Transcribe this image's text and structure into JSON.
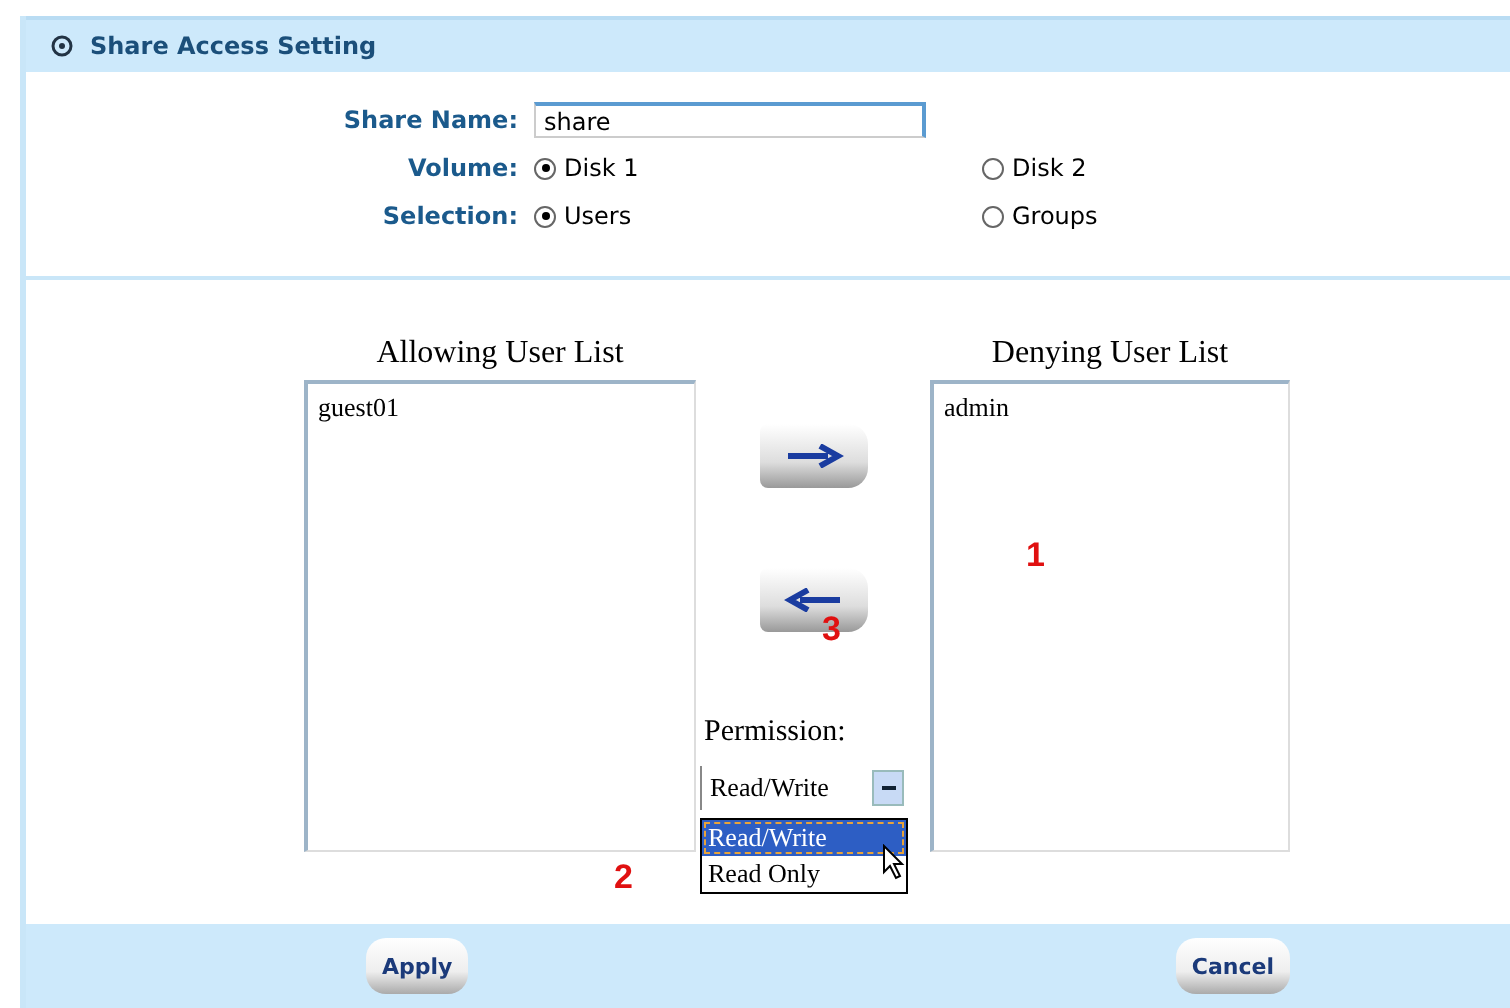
{
  "panel": {
    "title": "Share Access Setting"
  },
  "form": {
    "share_name": {
      "label": "Share Name:",
      "value": "share"
    },
    "volume": {
      "label": "Volume:",
      "options": [
        {
          "label": "Disk 1",
          "selected": true
        },
        {
          "label": "Disk 2",
          "selected": false
        }
      ]
    },
    "selection": {
      "label": "Selection:",
      "options": [
        {
          "label": "Users",
          "selected": true
        },
        {
          "label": "Groups",
          "selected": false
        }
      ]
    }
  },
  "allowing_list": {
    "title": "Allowing User List",
    "items": [
      "guest01"
    ]
  },
  "denying_list": {
    "title": "Denying User List",
    "items": [
      "admin"
    ]
  },
  "permission": {
    "label": "Permission:",
    "value": "Read/Write",
    "open": true,
    "options": [
      {
        "label": "Read/Write",
        "selected": true
      },
      {
        "label": "Read Only",
        "selected": false
      }
    ]
  },
  "annotations": [
    "1",
    "2",
    "3"
  ],
  "buttons": [
    "Apply",
    "Cancel"
  ]
}
